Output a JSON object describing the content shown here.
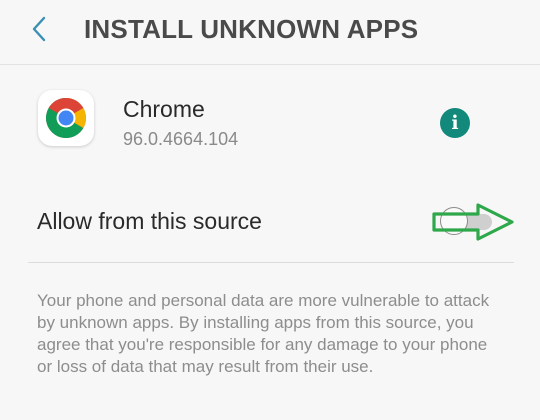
{
  "header": {
    "title": "INSTALL UNKNOWN APPS",
    "back_icon": "chevron-left-icon"
  },
  "app": {
    "name": "Chrome",
    "version": "96.0.4664.104",
    "icon": "chrome-logo-icon",
    "info_icon_glyph": "i"
  },
  "setting": {
    "label": "Allow from this source",
    "enabled": false
  },
  "warning_text": "Your phone and personal data are more vulnerable to attack by unknown apps. By installing apps from this source, you agree that you're responsible for any damage to your phone or loss of data that may result from their use.",
  "colors": {
    "accent": "#12897a",
    "back_arrow": "#3a8fb5",
    "annotation_arrow": "#2ea84a"
  }
}
